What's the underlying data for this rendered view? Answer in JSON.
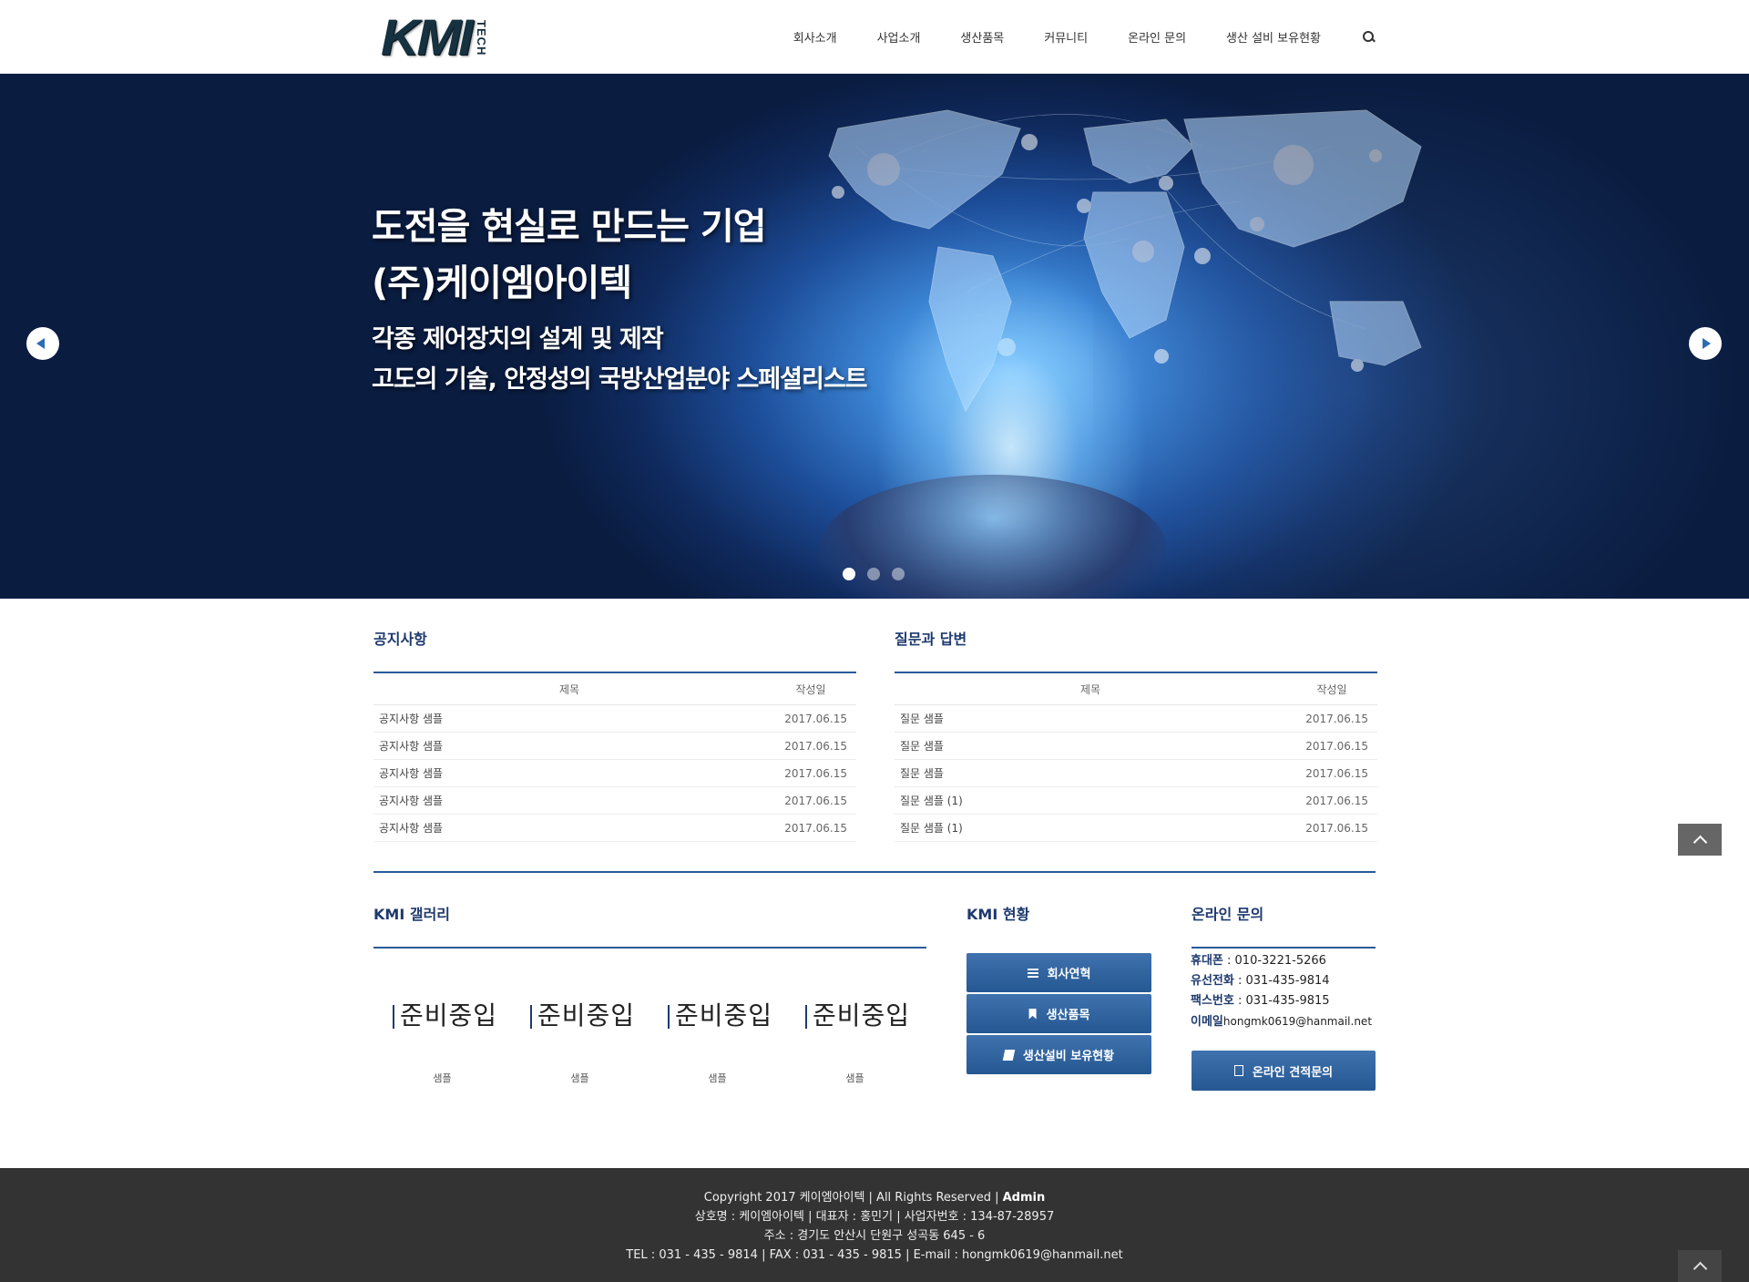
{
  "header": {
    "logo_text": "KMI",
    "logo_sub": "TECH",
    "nav": [
      "회사소개",
      "사업소개",
      "생산품목",
      "커뮤니티",
      "온라인 문의",
      "생산 설비 보유현황"
    ]
  },
  "hero": {
    "title_line1": "도전을 현실로 만드는 기업",
    "title_line2": "(주)케이엠아이텍",
    "sub_line1": "각종 제어장치의 설계 및 제작",
    "sub_line2": "고도의 기술, 안정성의 국방산업분야 스페셜리스트"
  },
  "notice": {
    "title": "공지사항",
    "col_title": "제목",
    "col_date": "작성일",
    "rows": [
      {
        "title": "공지사항 샘플",
        "date": "2017.06.15"
      },
      {
        "title": "공지사항 샘플",
        "date": "2017.06.15"
      },
      {
        "title": "공지사항 샘플",
        "date": "2017.06.15"
      },
      {
        "title": "공지사항 샘플",
        "date": "2017.06.15"
      },
      {
        "title": "공지사항 샘플",
        "date": "2017.06.15"
      }
    ]
  },
  "qna": {
    "title": "질문과 답변",
    "col_title": "제목",
    "col_date": "작성일",
    "rows": [
      {
        "title": "질문 샘플",
        "date": "2017.06.15"
      },
      {
        "title": "질문 샘플",
        "date": "2017.06.15"
      },
      {
        "title": "질문 샘플",
        "date": "2017.06.15"
      },
      {
        "title": "질문 샘플 (1)",
        "date": "2017.06.15"
      },
      {
        "title": "질문 샘플 (1)",
        "date": "2017.06.15"
      }
    ]
  },
  "gallery": {
    "title": "KMI 갤러리",
    "items": [
      {
        "image_text": "준비중입",
        "caption": "샘플"
      },
      {
        "image_text": "준비중입",
        "caption": "샘플"
      },
      {
        "image_text": "준비중입",
        "caption": "샘플"
      },
      {
        "image_text": "준비중입",
        "caption": "샘플"
      }
    ]
  },
  "status": {
    "title": "KMI 현황",
    "buttons": [
      "회사연혁",
      "생산품목",
      "생산설비 보유현황"
    ]
  },
  "contact": {
    "title": "온라인 문의",
    "mobile_label": "휴대폰",
    "mobile": " : 010-3221-5266",
    "phone_label": "유선전화",
    "phone": " : 031-435-9814",
    "fax_label": "팩스번호",
    "fax": " : 031-435-9815",
    "email_label": "이메일",
    "email": "hongmk0619@hanmail.net",
    "quote_button": "온라인 견적문의"
  },
  "footer": {
    "line1_text": "Copyright 2017 케이엠아이텍 | All Rights Reserved | ",
    "line1_bold": "Admin",
    "line2": "상호명 : 케이엠아이텍 | 대표자 : 홍민기 | 사업자번호 : 134-87-28957",
    "line3": "주소 : 경기도 안산시 단원구 성곡동 645 - 6",
    "line4": "TEL : 031 - 435 - 9814 | FAX : 031 - 435 - 9815 | E-mail : hongmk0619@hanmail.net"
  },
  "colors": {
    "accent": "#2a5a9a",
    "heading": "#1e3a6e",
    "button": "#255892",
    "footer_bg": "#333333"
  }
}
